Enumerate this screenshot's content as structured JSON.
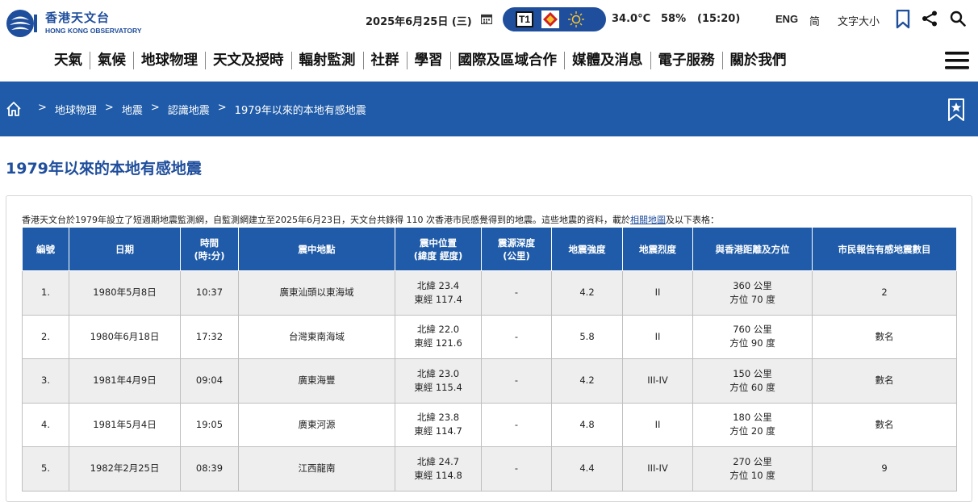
{
  "header": {
    "logo_zh": "香港天文台",
    "logo_en": "HONG KONG OBSERVATORY",
    "date": "2025年6月25日 (三)",
    "signal_label": "T1",
    "temperature": "34.0°C",
    "humidity": "58%",
    "update_time": "(15:20)",
    "lang_eng": "ENG",
    "lang_simplified": "简",
    "font_size": "文字大小"
  },
  "nav": [
    "天氣",
    "氣候",
    "地球物理",
    "天文及授時",
    "輻射監測",
    "社群",
    "學習",
    "國際及區域合作",
    "媒體及消息",
    "電子服務",
    "關於我們"
  ],
  "breadcrumb": [
    "地球物理",
    "地震",
    "認識地震",
    "1979年以來的本地有感地震"
  ],
  "page_title": "1979年以來的本地有感地震",
  "intro": {
    "text": "香港天文台於1979年設立了短週期地震監測網，自監測網建立至2025年6月23日，天文台共錄得 110 次香港市民感覺得到的地震。這些地震的資料，載於",
    "link": "相關地圖",
    "suffix": "及以下表格："
  },
  "table": {
    "headers": [
      "編號",
      "日期",
      "時間\n(時:分)",
      "震中地點",
      "震中位置\n(緯度 經度)",
      "震源深度\n(公里)",
      "地震強度",
      "地震烈度",
      "與香港距離及方位",
      "市民報告有感地震數目"
    ],
    "rows": [
      {
        "no": "1.",
        "date": "1980年5月8日",
        "time": "10:37",
        "place": "廣東汕頭以東海域",
        "lat": "北緯 23.4",
        "lon": "東經 117.4",
        "depth": "-",
        "magnitude": "4.2",
        "intensity": "II",
        "distance": "360 公里",
        "bearing": "方位 70 度",
        "reports": "2"
      },
      {
        "no": "2.",
        "date": "1980年6月18日",
        "time": "17:32",
        "place": "台灣東南海域",
        "lat": "北緯 22.0",
        "lon": "東經 121.6",
        "depth": "-",
        "magnitude": "5.8",
        "intensity": "II",
        "distance": "760 公里",
        "bearing": "方位 90 度",
        "reports": "數名"
      },
      {
        "no": "3.",
        "date": "1981年4月9日",
        "time": "09:04",
        "place": "廣東海豐",
        "lat": "北緯 23.0",
        "lon": "東經 115.4",
        "depth": "-",
        "magnitude": "4.2",
        "intensity": "III-IV",
        "distance": "150 公里",
        "bearing": "方位 60 度",
        "reports": "數名"
      },
      {
        "no": "4.",
        "date": "1981年5月4日",
        "time": "19:05",
        "place": "廣東河源",
        "lat": "北緯 23.8",
        "lon": "東經 114.7",
        "depth": "-",
        "magnitude": "4.8",
        "intensity": "II",
        "distance": "180 公里",
        "bearing": "方位 20 度",
        "reports": "數名"
      },
      {
        "no": "5.",
        "date": "1982年2月25日",
        "time": "08:39",
        "place": "江西龍南",
        "lat": "北緯 24.7",
        "lon": "東經 114.8",
        "depth": "-",
        "magnitude": "4.4",
        "intensity": "III-IV",
        "distance": "270 公里",
        "bearing": "方位 10 度",
        "reports": "9"
      }
    ]
  },
  "colors": {
    "brand_blue": "#1f4e9c",
    "band_blue": "#1f5ba8",
    "row_alt": "#eeeeee"
  },
  "icons": [
    "calendar-icon",
    "typhoon-signal-icon",
    "hot-weather-icon",
    "sunny-icon",
    "bookmark-icon",
    "share-icon",
    "search-icon",
    "hamburger-icon",
    "home-icon",
    "favourite-icon"
  ]
}
